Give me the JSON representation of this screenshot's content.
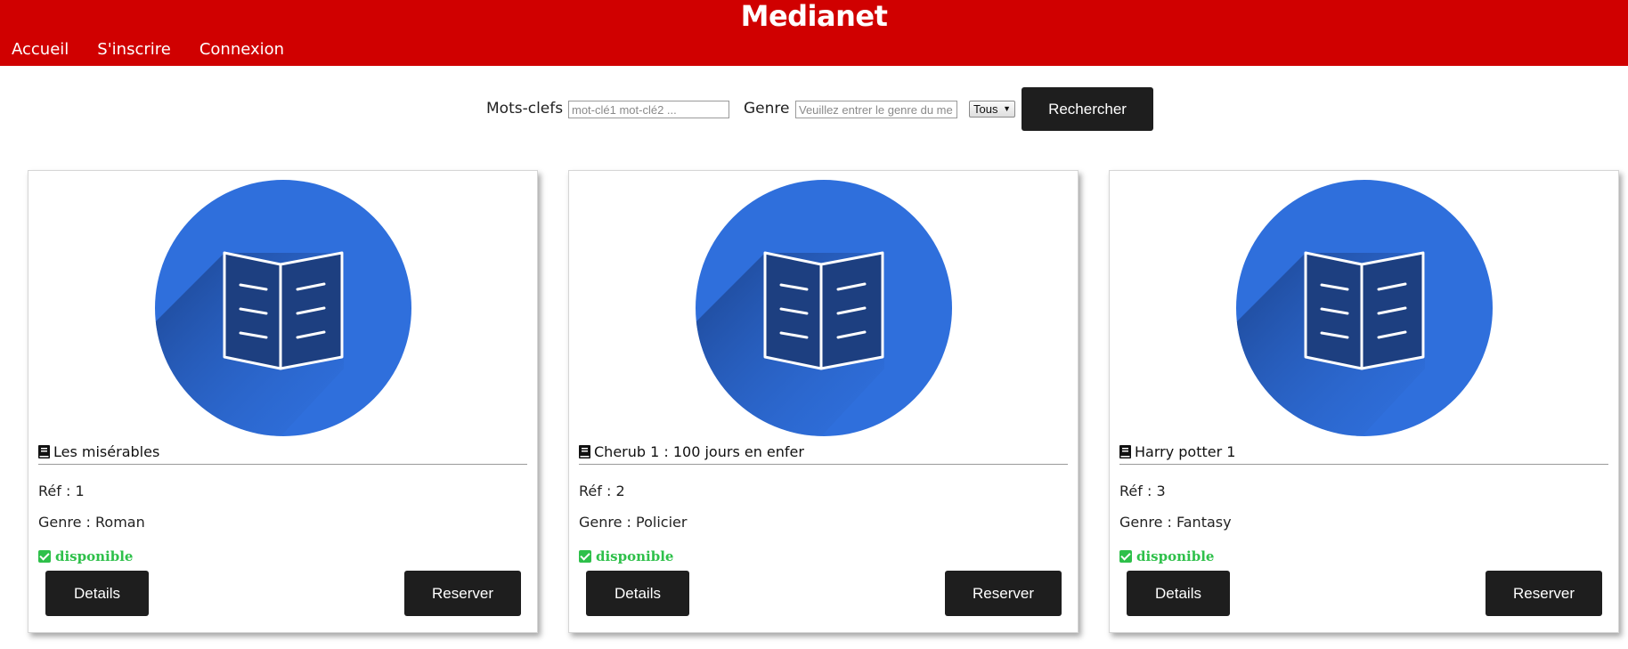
{
  "app": {
    "brand": "Medianet",
    "header_color": "#d00000"
  },
  "nav": {
    "items": [
      "Accueil",
      "S'inscrire",
      "Connexion"
    ]
  },
  "search": {
    "keywords_label": "Mots-clefs",
    "keywords_placeholder": "mot-clé1 mot-clé2 ...",
    "genre_label": "Genre",
    "genre_placeholder": "Veuillez entrer le genre du me",
    "type_select": "Tous",
    "submit_label": "Rechercher"
  },
  "items": [
    {
      "title": "Les misérables",
      "ref_label": "Réf : 1",
      "genre_label": "Genre : Roman",
      "status": "disponible",
      "details_label": "Details",
      "reserve_label": "Reserver"
    },
    {
      "title": "Cherub 1 : 100 jours en enfer",
      "ref_label": "Réf : 2",
      "genre_label": "Genre : Policier",
      "status": "disponible",
      "details_label": "Details",
      "reserve_label": "Reserver"
    },
    {
      "title": "Harry potter 1",
      "ref_label": "Réf : 3",
      "genre_label": "Genre : Fantasy",
      "status": "disponible",
      "details_label": "Details",
      "reserve_label": "Reserver"
    }
  ],
  "colors": {
    "cover_circle": "#2f6fdc",
    "cover_shadow": "#1c4a9e",
    "available": "#2ec04a",
    "button": "#1e1e1e"
  },
  "icons": {
    "cover": "open-book-icon",
    "title": "book-icon",
    "status": "check-square-icon"
  }
}
